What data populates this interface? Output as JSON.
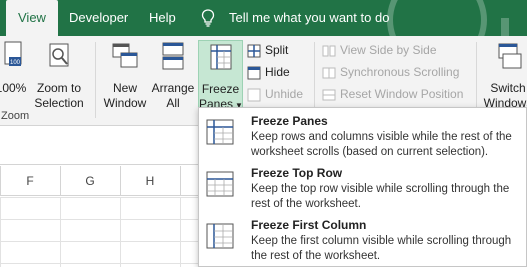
{
  "tabs": [
    {
      "label": "View",
      "active": true
    },
    {
      "label": "Developer",
      "active": false
    },
    {
      "label": "Help",
      "active": false
    }
  ],
  "tell_me": "Tell me what you want to do",
  "ribbon": {
    "zoom_100_label": "100%",
    "zoom_to_selection_line1": "Zoom to",
    "zoom_to_selection_line2": "Selection",
    "zoom_group_label": "Zoom",
    "new_window_line1": "New",
    "new_window_line2": "Window",
    "arrange_all_line1": "Arrange",
    "arrange_all_line2": "All",
    "freeze_panes_line1": "Freeze",
    "freeze_panes_line2": "Panes",
    "split": "Split",
    "hide": "Hide",
    "unhide": "Unhide",
    "view_side_by_side": "View Side by Side",
    "synchronous_scrolling": "Synchronous Scrolling",
    "reset_window_position": "Reset Window Position",
    "switch_windows_line1": "Switch",
    "switch_windows_line2": "Windows"
  },
  "columns": [
    "F",
    "G",
    "H"
  ],
  "freeze_menu": [
    {
      "title": "Freeze Panes",
      "description": "Keep rows and columns visible while the rest of the worksheet scrolls (based on current selection)."
    },
    {
      "title": "Freeze Top Row",
      "description": "Keep the top row visible while scrolling through the rest of the worksheet."
    },
    {
      "title": "Freeze First Column",
      "description": "Keep the first column visible while scrolling through the rest of the worksheet."
    }
  ],
  "colors": {
    "brand": "#217346",
    "active_button": "#c6e7d3"
  }
}
